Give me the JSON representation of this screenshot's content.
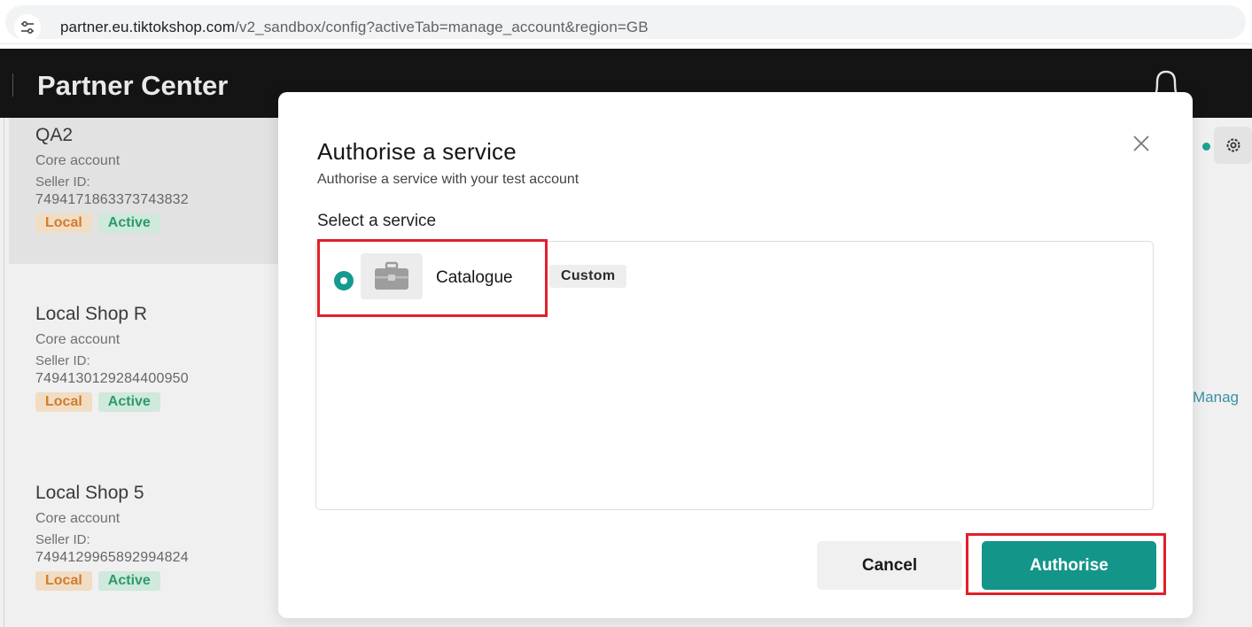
{
  "browser": {
    "url_host": "partner.eu.tiktokshop.com",
    "url_path": "/v2_sandbox/config?activeTab=manage_account&region=GB",
    "site_info_icon": "tune-icon"
  },
  "header": {
    "title": "Partner Center",
    "bell_icon": "bell-icon"
  },
  "shops": [
    {
      "name": "QA2",
      "type": "Core account",
      "seller_id_label": "Seller ID:",
      "seller_id": "7494171863373743832",
      "tag_local": "Local",
      "tag_active": "Active"
    },
    {
      "name": "Local Shop R",
      "type": "Core account",
      "seller_id_label": "Seller ID:",
      "seller_id": "7494130129284400950",
      "tag_local": "Local",
      "tag_active": "Active"
    },
    {
      "name": "Local Shop 5",
      "type": "Core account",
      "seller_id_label": "Seller ID:",
      "seller_id": "7494129965892994824",
      "tag_local": "Local",
      "tag_active": "Active"
    }
  ],
  "background_right": {
    "manage_link": "Manag",
    "settings_icon": "gear-icon"
  },
  "modal": {
    "title": "Authorise a service",
    "subtitle": "Authorise a service with your test account",
    "select_label": "Select a service",
    "services": [
      {
        "name": "Catalogue",
        "badge": "Custom",
        "icon": "briefcase-icon",
        "selected": true
      }
    ],
    "cancel_label": "Cancel",
    "authorise_label": "Authorise"
  },
  "colors": {
    "accent": "#14958a",
    "highlight": "#e0202a",
    "header_bg": "#141414"
  }
}
